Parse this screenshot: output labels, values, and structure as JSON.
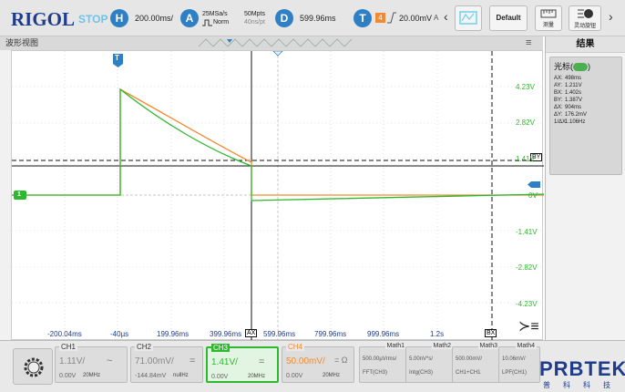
{
  "topbar": {
    "logo": "RIGOL",
    "run_status": "STOP",
    "h_letter": "H",
    "timebase": "200.00ms/",
    "a_letter": "A",
    "sample_rate": "25MSa/s",
    "trigger_mode": "Norm",
    "mem_depth": "50Mpts",
    "pts_rate": "40ns/pt",
    "d_letter": "D",
    "delay": "599.96ms",
    "t_letter": "T",
    "trig_channel": "4",
    "trig_level": "20.00mV",
    "trig_extra": "A",
    "default_label": "Default",
    "measure_label": "测量",
    "gesture_label": "灵动旋钮"
  },
  "panel": {
    "title": "波形视图",
    "menu_icon": "menu-icon"
  },
  "result": {
    "title": "结果",
    "cursor_label": "光标",
    "rows": [
      {
        "k": "AX:",
        "v": "498ms"
      },
      {
        "k": "AY:",
        "v": "1.211V"
      },
      {
        "k": "BX:",
        "v": "1.402s"
      },
      {
        "k": "BY:",
        "v": "1.387V"
      },
      {
        "k": "ΔX:",
        "v": "904ms"
      },
      {
        "k": "ΔY:",
        "v": "176.2mV"
      },
      {
        "k": "1/ΔX:",
        "v": "1.106Hz"
      }
    ]
  },
  "grid": {
    "x_labels": [
      "-200.04ms",
      "-40µs",
      "199.96ms",
      "399.96ms",
      "599.96ms",
      "799.96ms",
      "999.96ms",
      "1.2s"
    ],
    "y_labels": [
      "4.23V",
      "2.82V",
      "1.41V",
      "0V",
      "-1.41V",
      "-2.82V",
      "-4.23V"
    ],
    "cursor_ax": "AX",
    "cursor_bx": "BX",
    "cursor_by": "BY",
    "trigger_marker": "T",
    "ch1_marker": "1"
  },
  "channels": [
    {
      "name": "CH1",
      "scale": "1.11V/",
      "offset": "0.00V",
      "bw": "20MHz",
      "coupling": "~"
    },
    {
      "name": "CH2",
      "scale": "71.00mV/",
      "offset": "-144.84mV",
      "bw": "nullHz",
      "coupling": "="
    },
    {
      "name": "CH3",
      "scale": "1.41V/",
      "offset": "0.00V",
      "bw": "20MHz",
      "coupling": "="
    },
    {
      "name": "CH4",
      "scale": "50.00mV/",
      "offset": "0.00V",
      "bw": "20MHz",
      "coupling": "= Ω"
    }
  ],
  "math": [
    {
      "name": "Math1",
      "l1": "500.00µVrms/",
      "l2": "FFT(CH3)"
    },
    {
      "name": "Math2",
      "l1": "5.00nV*s/",
      "l2": "Intg(CH3)"
    },
    {
      "name": "Math3",
      "l1": "500.00mV/",
      "l2": "CH1+CH1"
    },
    {
      "name": "Math4",
      "l1": "10.06mV/",
      "l2": "LPF(CH1)"
    }
  ],
  "brand": {
    "name": "PRBTEK",
    "sub": "普科科技"
  },
  "colors": {
    "ch3": "#2eb82e",
    "ch4": "#f28a32",
    "accent": "#1f3c8c"
  }
}
